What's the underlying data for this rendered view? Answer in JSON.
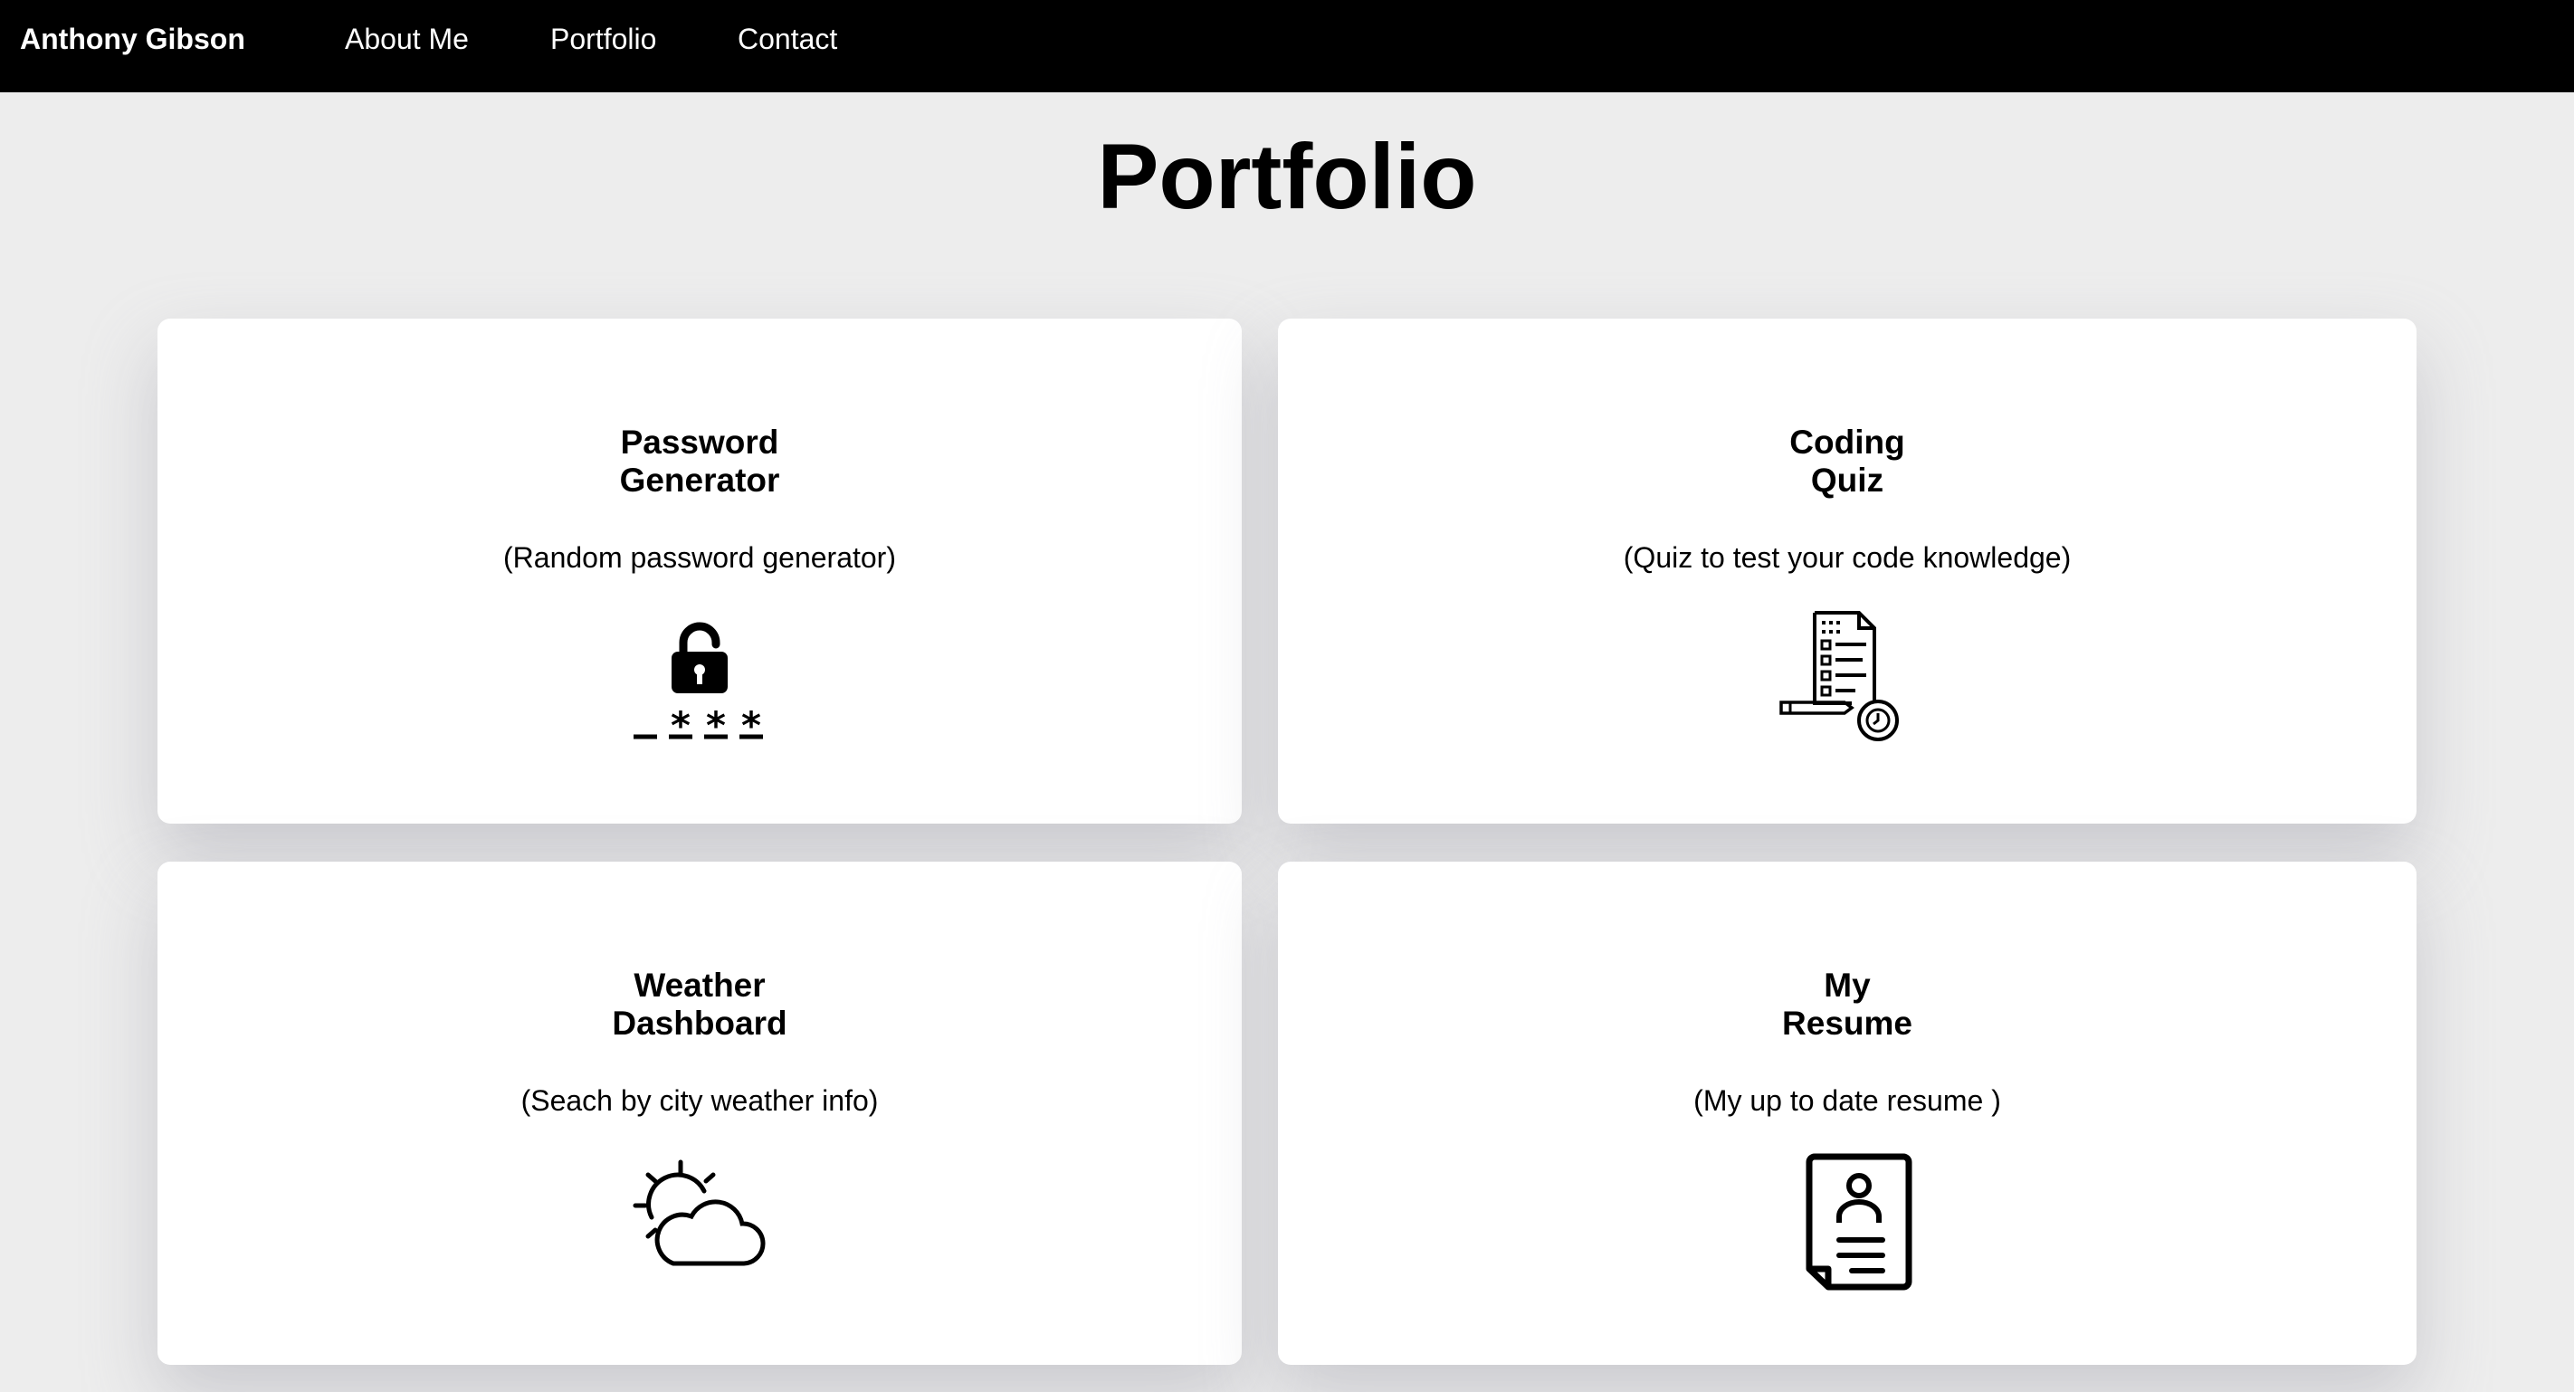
{
  "nav": {
    "brand": "Anthony Gibson",
    "links": [
      "About Me",
      "Portfolio",
      "Contact"
    ]
  },
  "page": {
    "title": "Portfolio"
  },
  "projects": [
    {
      "title": "Password\nGenerator",
      "desc": "(Random password generator)",
      "icon": "password-lock-icon"
    },
    {
      "title": "Coding\nQuiz",
      "desc": "(Quiz to test your code knowledge)",
      "icon": "quiz-document-icon"
    },
    {
      "title": "Weather\nDashboard",
      "desc": "(Seach by city weather info)",
      "icon": "sun-cloud-icon"
    },
    {
      "title": "My\nResume",
      "desc": "(My up to date resume )",
      "icon": "resume-document-icon"
    }
  ],
  "colors": {
    "navbar": "#000000",
    "background": "#ededed",
    "card": "#ffffff"
  }
}
